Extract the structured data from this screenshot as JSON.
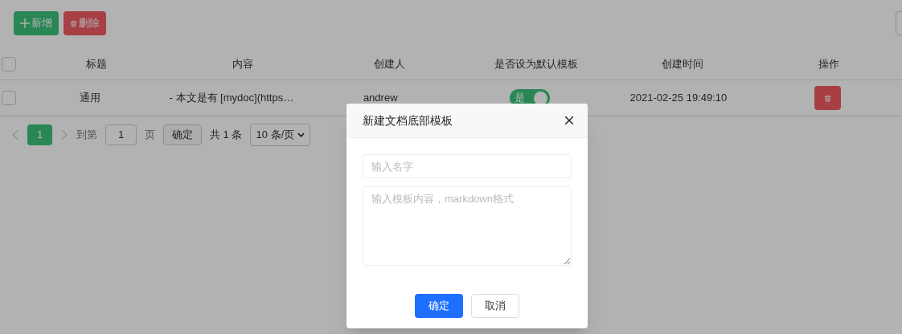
{
  "toolbar": {
    "buttons": [
      {
        "label": "新增",
        "kind": "add"
      },
      {
        "label": "删除",
        "kind": "delete"
      }
    ]
  },
  "table": {
    "all_checked": false,
    "columns": [
      "标题",
      "内容",
      "创建人",
      "是否设为默认模板",
      "创建时间",
      "操作"
    ],
    "rows": [
      {
        "checked": false,
        "title": "通用",
        "content": "- 本文是有 [mydoc](https…",
        "creator": "andrew",
        "default": {
          "label": "是",
          "on": true
        },
        "created": "2021-02-25 19:49:10"
      }
    ]
  },
  "pagination": {
    "pages": [
      {
        "label": "1",
        "selected": true
      }
    ],
    "goto_label": "到第",
    "goto_value": "1",
    "page_unit": "页",
    "confirm": "确定",
    "total": "共 1 条",
    "page_size": "10 条/页"
  },
  "dialog": {
    "title": "新建文档底部模板",
    "fields": [
      {
        "kind": "input",
        "placeholder": "输入名字"
      },
      {
        "kind": "textarea",
        "placeholder": "输入模板内容，markdown格式"
      }
    ],
    "buttons": [
      {
        "label": "确定",
        "kind": "primary"
      },
      {
        "label": "取消",
        "kind": "default"
      }
    ]
  }
}
